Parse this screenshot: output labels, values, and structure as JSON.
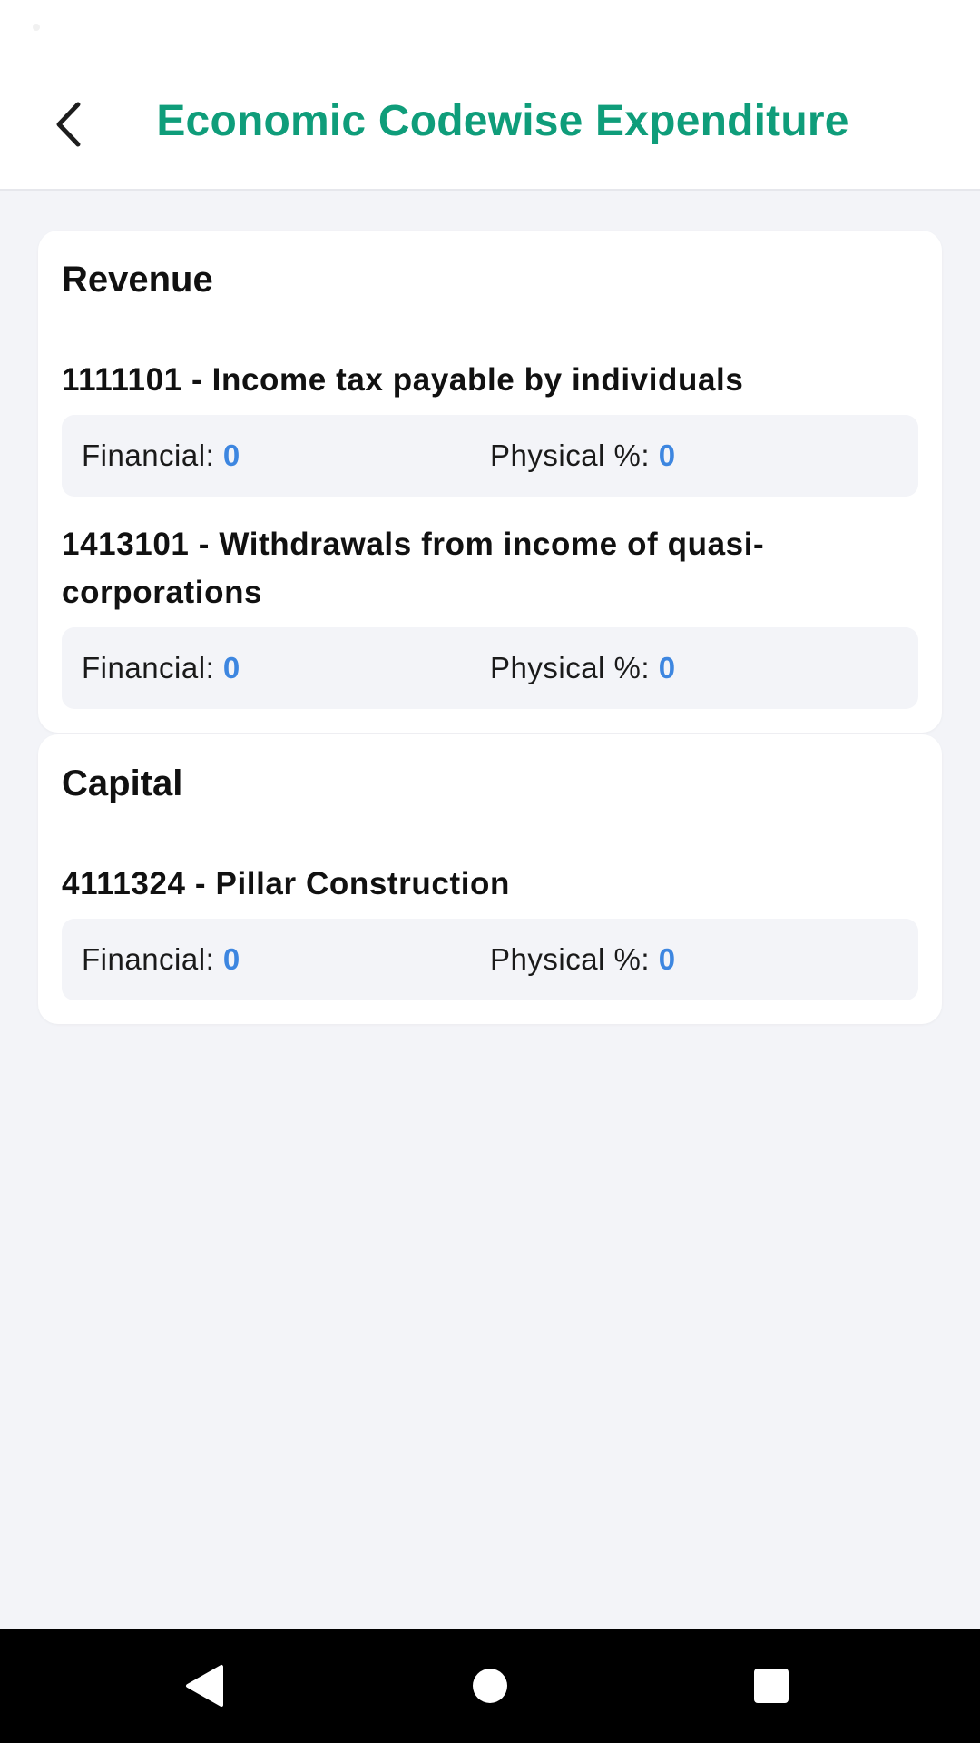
{
  "header": {
    "title": "Economic Codewise Expenditure",
    "back_icon": "chevron-left-icon"
  },
  "sections": [
    {
      "title": "Revenue",
      "items": [
        {
          "title": "1111101 - Income tax payable by individuals",
          "financial_label": "Financial:",
          "financial_value": "0",
          "physical_label": "Physical %:",
          "physical_value": "0"
        },
        {
          "title": "1413101 - Withdrawals from income of quasi-corporations",
          "financial_label": "Financial:",
          "financial_value": "0",
          "physical_label": "Physical %:",
          "physical_value": "0"
        }
      ]
    },
    {
      "title": "Capital",
      "items": [
        {
          "title": "4111324 - Pillar Construction",
          "financial_label": "Financial:",
          "financial_value": "0",
          "physical_label": "Physical %:",
          "physical_value": "0"
        }
      ]
    }
  ],
  "system_nav": {
    "back_icon": "nav-back-icon",
    "home_icon": "nav-home-icon",
    "recents_icon": "nav-recents-icon"
  },
  "colors": {
    "title_accent": "#0f9d7a",
    "value_accent": "#3d86e0",
    "background": "#f3f4f8",
    "card": "#ffffff"
  }
}
